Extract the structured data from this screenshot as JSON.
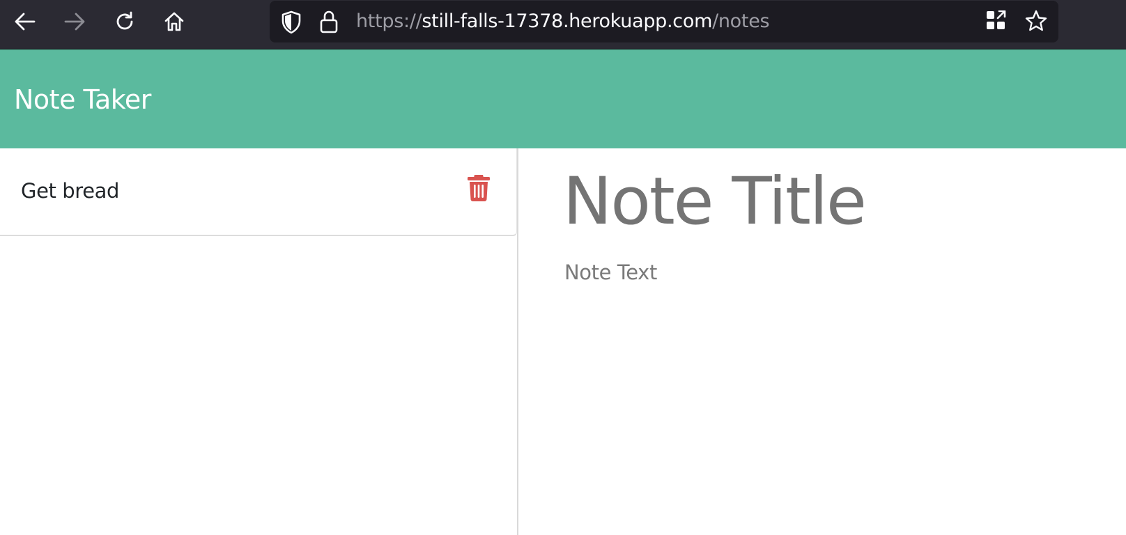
{
  "browser": {
    "url_scheme": "https://",
    "url_host": "still-falls-17378.herokuapp.com",
    "url_path": "/notes",
    "icons": {
      "back": "arrow-left-icon",
      "forward": "arrow-right-icon",
      "reload": "reload-icon",
      "home": "home-icon",
      "tracking_protection": "shield-icon",
      "security": "lock-icon",
      "extension": "grid-arrow-icon",
      "bookmark": "star-icon"
    }
  },
  "header": {
    "title": "Note Taker",
    "background_color": "#5bba9e"
  },
  "notes": [
    {
      "title": "Get bread",
      "delete_icon": "trash-icon",
      "delete_color": "#d9534f"
    }
  ],
  "editor": {
    "title_placeholder": "Note Title",
    "text_placeholder": "Note Text"
  }
}
